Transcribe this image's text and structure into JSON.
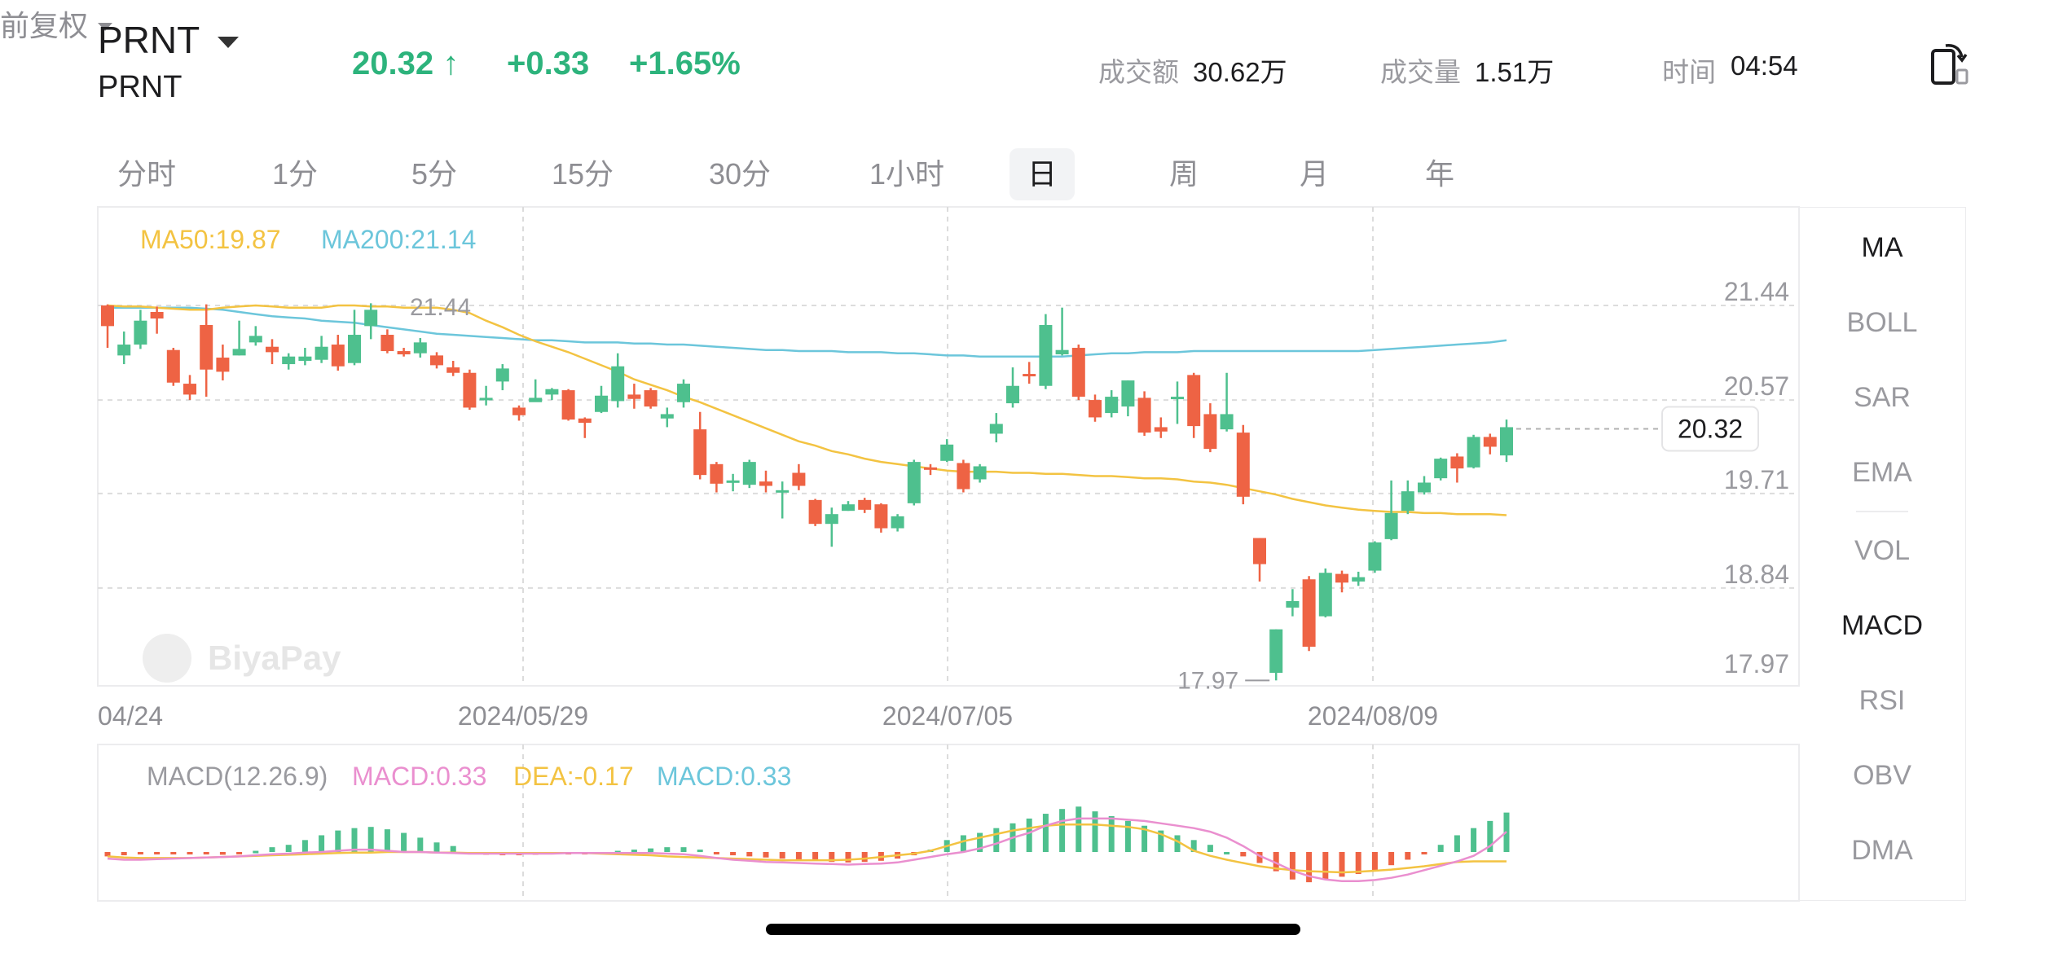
{
  "header": {
    "symbol": "PRNT",
    "symbol_sub": "PRNT",
    "price": "20.32 ↑",
    "change": "+0.33",
    "change_pct": "+1.65%",
    "turnover_label": "成交额",
    "turnover_value": "30.62万",
    "volume_label": "成交量",
    "volume_value": "1.51万",
    "time_label": "时间",
    "time_value": "04:54"
  },
  "tabs": [
    "分时",
    "1分",
    "5分",
    "15分",
    "30分",
    "1小时",
    "日",
    "周",
    "月",
    "年"
  ],
  "active_tab": "日",
  "adjust_label": "前复权",
  "indicators": [
    "MA",
    "BOLL",
    "SAR",
    "EMA",
    "VOL",
    "MACD",
    "RSI",
    "OBV",
    "DMA"
  ],
  "active_indicators": [
    "MA",
    "MACD"
  ],
  "colors": {
    "up": "#4ec08e",
    "down": "#ee6344",
    "ma50": "#f3c342",
    "ma200": "#6cc6db",
    "macd": "#ea8fcf",
    "dea": "#f3c342",
    "hist_label": "#6cc6db"
  },
  "chart_data": {
    "type": "candlestick",
    "legend": {
      "ma50": "MA50:19.87",
      "ma200": "MA200:21.14"
    },
    "y_ticks": [
      "21.44",
      "20.57",
      "19.71",
      "18.84",
      "17.97"
    ],
    "ylim": [
      17.97,
      22.0
    ],
    "x_labels": [
      "04/24",
      "2024/05/29",
      "2024/07/05",
      "2024/08/09"
    ],
    "max_label": "21.44",
    "min_label": "17.97",
    "last_price_label": "20.32",
    "watermark": "BiyaPay",
    "candles": [
      [
        21.44,
        21.25,
        21.45,
        21.05
      ],
      [
        20.98,
        21.08,
        21.2,
        20.9
      ],
      [
        21.08,
        21.3,
        21.4,
        21.04
      ],
      [
        21.38,
        21.32,
        21.43,
        21.18
      ],
      [
        21.03,
        20.73,
        21.05,
        20.7
      ],
      [
        20.72,
        20.62,
        20.8,
        20.57
      ],
      [
        21.26,
        20.85,
        21.45,
        20.6
      ],
      [
        20.96,
        20.83,
        21.08,
        20.75
      ],
      [
        20.98,
        21.04,
        21.3,
        20.98
      ],
      [
        21.1,
        21.16,
        21.25,
        21.07
      ],
      [
        21.06,
        21.01,
        21.13,
        20.9
      ],
      [
        20.9,
        20.97,
        21.0,
        20.85
      ],
      [
        20.93,
        20.97,
        21.05,
        20.89
      ],
      [
        20.94,
        21.06,
        21.16,
        20.91
      ],
      [
        21.08,
        20.88,
        21.17,
        20.84
      ],
      [
        20.91,
        21.17,
        21.4,
        20.89
      ],
      [
        21.25,
        21.4,
        21.46,
        21.13
      ],
      [
        21.17,
        21.02,
        21.22,
        21.0
      ],
      [
        21.02,
        20.99,
        21.05,
        20.97
      ],
      [
        21.0,
        21.1,
        21.14,
        20.96
      ],
      [
        20.98,
        20.89,
        21.01,
        20.86
      ],
      [
        20.87,
        20.82,
        20.93,
        20.79
      ],
      [
        20.82,
        20.5,
        20.85,
        20.48
      ],
      [
        20.57,
        20.59,
        20.7,
        20.52
      ],
      [
        20.74,
        20.86,
        20.9,
        20.66
      ],
      [
        20.5,
        20.43,
        20.52,
        20.38
      ],
      [
        20.55,
        20.59,
        20.76,
        20.56
      ],
      [
        20.62,
        20.67,
        20.68,
        20.57
      ],
      [
        20.66,
        20.39,
        20.67,
        20.38
      ],
      [
        20.4,
        20.36,
        20.41,
        20.22
      ],
      [
        20.46,
        20.61,
        20.7,
        20.45
      ],
      [
        20.56,
        20.88,
        21.0,
        20.5
      ],
      [
        20.62,
        20.58,
        20.72,
        20.49
      ],
      [
        20.66,
        20.51,
        20.68,
        20.49
      ],
      [
        20.4,
        20.44,
        20.5,
        20.32
      ],
      [
        20.55,
        20.72,
        20.76,
        20.5
      ],
      [
        20.3,
        19.88,
        20.46,
        19.84
      ],
      [
        19.98,
        19.8,
        20.0,
        19.72
      ],
      [
        19.82,
        19.83,
        19.89,
        19.73
      ],
      [
        19.79,
        20.0,
        20.02,
        19.76
      ],
      [
        19.82,
        19.78,
        19.92,
        19.72
      ],
      [
        19.72,
        19.74,
        19.82,
        19.48
      ],
      [
        19.9,
        19.78,
        19.98,
        19.74
      ],
      [
        19.65,
        19.43,
        19.66,
        19.41
      ],
      [
        19.43,
        19.52,
        19.58,
        19.22
      ],
      [
        19.55,
        19.61,
        19.64,
        19.55
      ],
      [
        19.65,
        19.56,
        19.67,
        19.53
      ],
      [
        19.61,
        19.39,
        19.62,
        19.35
      ],
      [
        19.39,
        19.5,
        19.52,
        19.36
      ],
      [
        19.62,
        20.0,
        20.02,
        19.6
      ],
      [
        19.95,
        19.93,
        19.98,
        19.88
      ],
      [
        20.01,
        20.16,
        20.21,
        20.0
      ],
      [
        19.99,
        19.75,
        20.02,
        19.72
      ],
      [
        19.84,
        19.96,
        19.98,
        19.81
      ],
      [
        20.26,
        20.35,
        20.45,
        20.18
      ],
      [
        20.54,
        20.7,
        20.87,
        20.5
      ],
      [
        20.81,
        20.79,
        20.92,
        20.72
      ],
      [
        20.7,
        21.26,
        21.36,
        20.67
      ],
      [
        20.99,
        21.03,
        21.42,
        20.98
      ],
      [
        21.05,
        20.6,
        21.08,
        20.57
      ],
      [
        20.57,
        20.41,
        20.62,
        20.37
      ],
      [
        20.45,
        20.6,
        20.66,
        20.41
      ],
      [
        20.51,
        20.75,
        20.75,
        20.42
      ],
      [
        20.59,
        20.27,
        20.65,
        20.24
      ],
      [
        20.32,
        20.28,
        20.41,
        20.22
      ],
      [
        20.6,
        20.6,
        20.74,
        20.35
      ],
      [
        20.8,
        20.33,
        20.82,
        20.22
      ],
      [
        20.44,
        20.12,
        20.54,
        20.09
      ],
      [
        20.3,
        20.44,
        20.82,
        20.28
      ],
      [
        20.27,
        19.68,
        20.34,
        19.61
      ],
      [
        19.3,
        19.06,
        19.3,
        18.9
      ],
      [
        18.06,
        18.46,
        18.46,
        17.99
      ],
      [
        18.66,
        18.72,
        18.83,
        18.58
      ],
      [
        18.92,
        18.3,
        18.95,
        18.26
      ],
      [
        18.58,
        18.98,
        19.02,
        18.57
      ],
      [
        18.97,
        18.89,
        19.0,
        18.8
      ],
      [
        18.9,
        18.94,
        18.99,
        18.86
      ],
      [
        19.0,
        19.26,
        19.27,
        18.98
      ],
      [
        19.29,
        19.53,
        19.83,
        19.28
      ],
      [
        19.55,
        19.73,
        19.83,
        19.52
      ],
      [
        19.72,
        19.81,
        19.87,
        19.7
      ],
      [
        19.85,
        20.03,
        20.04,
        19.83
      ],
      [
        20.05,
        19.94,
        20.08,
        19.81
      ],
      [
        19.95,
        20.23,
        20.25,
        19.94
      ],
      [
        20.23,
        20.14,
        20.26,
        20.07
      ],
      [
        20.06,
        20.32,
        20.39,
        20.0
      ]
    ],
    "ma50": [
      21.44,
      21.43,
      21.43,
      21.42,
      21.41,
      21.4,
      21.4,
      21.42,
      21.43,
      21.44,
      21.43,
      21.42,
      21.42,
      21.42,
      21.44,
      21.44,
      21.43,
      21.43,
      21.42,
      21.42,
      21.42,
      21.4,
      21.37,
      21.3,
      21.24,
      21.17,
      21.11,
      21.06,
      21.01,
      20.95,
      20.89,
      20.83,
      20.76,
      20.71,
      20.66,
      20.6,
      20.55,
      20.49,
      20.43,
      20.37,
      20.31,
      20.25,
      20.19,
      20.15,
      20.1,
      20.07,
      20.03,
      20.0,
      19.98,
      19.96,
      19.94,
      19.92,
      19.91,
      19.91,
      19.91,
      19.9,
      19.9,
      19.89,
      19.89,
      19.88,
      19.87,
      19.87,
      19.86,
      19.85,
      19.85,
      19.84,
      19.82,
      19.81,
      19.79,
      19.76,
      19.73,
      19.7,
      19.66,
      19.63,
      19.6,
      19.58,
      19.56,
      19.55,
      19.54,
      19.54,
      19.53,
      19.53,
      19.52,
      19.52,
      19.52,
      19.51
    ],
    "ma200": [
      21.42,
      21.42,
      21.42,
      21.42,
      21.42,
      21.42,
      21.41,
      21.4,
      21.38,
      21.36,
      21.34,
      21.33,
      21.32,
      21.3,
      21.29,
      21.28,
      21.26,
      21.24,
      21.22,
      21.2,
      21.18,
      21.17,
      21.16,
      21.15,
      21.14,
      21.13,
      21.12,
      21.12,
      21.11,
      21.1,
      21.1,
      21.1,
      21.09,
      21.09,
      21.08,
      21.08,
      21.07,
      21.06,
      21.05,
      21.04,
      21.03,
      21.03,
      21.02,
      21.02,
      21.02,
      21.01,
      21.01,
      21.01,
      21.0,
      21.0,
      20.99,
      20.98,
      20.98,
      20.97,
      20.97,
      20.97,
      20.97,
      20.97,
      20.97,
      20.98,
      20.99,
      21.0,
      21.0,
      21.01,
      21.01,
      21.01,
      21.02,
      21.02,
      21.02,
      21.02,
      21.02,
      21.02,
      21.02,
      21.02,
      21.02,
      21.02,
      21.02,
      21.03,
      21.04,
      21.05,
      21.06,
      21.07,
      21.08,
      21.09,
      21.1,
      21.12
    ],
    "macd_panel": {
      "legend_title": "MACD(12.26.9)",
      "macd_label": "MACD:0.33",
      "dea_label": "DEA:-0.17",
      "hist_label": "MACD:0.33",
      "ylim": [
        -0.8,
        0.45
      ],
      "hist": [
        -0.08,
        -0.06,
        -0.04,
        -0.03,
        -0.02,
        -0.03,
        -0.04,
        -0.05,
        -0.03,
        0.01,
        0.04,
        0.06,
        0.1,
        0.14,
        0.18,
        0.2,
        0.21,
        0.19,
        0.16,
        0.12,
        0.08,
        0.05,
        0.0,
        -0.05,
        -0.06,
        -0.06,
        -0.05,
        -0.04,
        -0.03,
        -0.02,
        -0.01,
        0.01,
        0.02,
        0.03,
        0.04,
        0.04,
        0.02,
        -0.03,
        -0.06,
        -0.08,
        -0.1,
        -0.12,
        -0.14,
        -0.16,
        -0.18,
        -0.19,
        -0.18,
        -0.16,
        -0.12,
        -0.06,
        0.02,
        0.1,
        0.14,
        0.16,
        0.2,
        0.24,
        0.28,
        0.32,
        0.36,
        0.38,
        0.34,
        0.3,
        0.26,
        0.22,
        0.18,
        0.14,
        0.1,
        0.06,
        0.0,
        -0.08,
        -0.2,
        -0.35,
        -0.5,
        -0.55,
        -0.5,
        -0.45,
        -0.4,
        -0.34,
        -0.24,
        -0.14,
        -0.04,
        0.06,
        0.14,
        0.2,
        0.26,
        0.33
      ],
      "macd": [
        -0.12,
        -0.14,
        -0.14,
        -0.13,
        -0.12,
        -0.11,
        -0.1,
        -0.09,
        -0.08,
        -0.06,
        -0.04,
        -0.03,
        -0.01,
        0.0,
        0.01,
        0.02,
        0.02,
        0.01,
        0.0,
        0.0,
        -0.01,
        -0.02,
        -0.03,
        -0.03,
        -0.03,
        -0.03,
        -0.03,
        -0.03,
        -0.02,
        -0.02,
        -0.02,
        -0.02,
        -0.02,
        -0.02,
        -0.03,
        -0.04,
        -0.07,
        -0.11,
        -0.14,
        -0.16,
        -0.18,
        -0.19,
        -0.2,
        -0.21,
        -0.22,
        -0.23,
        -0.22,
        -0.21,
        -0.19,
        -0.14,
        -0.09,
        -0.04,
        0.0,
        0.03,
        0.07,
        0.12,
        0.16,
        0.22,
        0.26,
        0.28,
        0.28,
        0.28,
        0.27,
        0.26,
        0.24,
        0.22,
        0.2,
        0.17,
        0.12,
        0.05,
        -0.07,
        -0.2,
        -0.34,
        -0.44,
        -0.5,
        -0.53,
        -0.53,
        -0.51,
        -0.47,
        -0.41,
        -0.33,
        -0.25,
        -0.17,
        -0.07,
        0.05,
        0.17
      ],
      "dea": [
        -0.08,
        -0.1,
        -0.11,
        -0.11,
        -0.11,
        -0.11,
        -0.1,
        -0.09,
        -0.08,
        -0.07,
        -0.06,
        -0.05,
        -0.04,
        -0.03,
        -0.02,
        -0.01,
        -0.01,
        0.0,
        0.0,
        0.0,
        -0.01,
        -0.01,
        -0.02,
        -0.02,
        -0.02,
        -0.02,
        -0.02,
        -0.02,
        -0.02,
        -0.02,
        -0.03,
        -0.04,
        -0.05,
        -0.06,
        -0.08,
        -0.09,
        -0.1,
        -0.11,
        -0.12,
        -0.13,
        -0.14,
        -0.15,
        -0.15,
        -0.15,
        -0.15,
        -0.14,
        -0.12,
        -0.09,
        -0.06,
        -0.03,
        0.01,
        0.05,
        0.09,
        0.12,
        0.15,
        0.18,
        0.2,
        0.22,
        0.23,
        0.23,
        0.23,
        0.22,
        0.21,
        0.19,
        0.15,
        0.09,
        0.01,
        -0.07,
        -0.14,
        -0.2,
        -0.26,
        -0.3,
        -0.33,
        -0.35,
        -0.36,
        -0.37,
        -0.36,
        -0.34,
        -0.32,
        -0.29,
        -0.26,
        -0.22,
        -0.18,
        -0.17,
        -0.17,
        -0.17
      ]
    }
  }
}
